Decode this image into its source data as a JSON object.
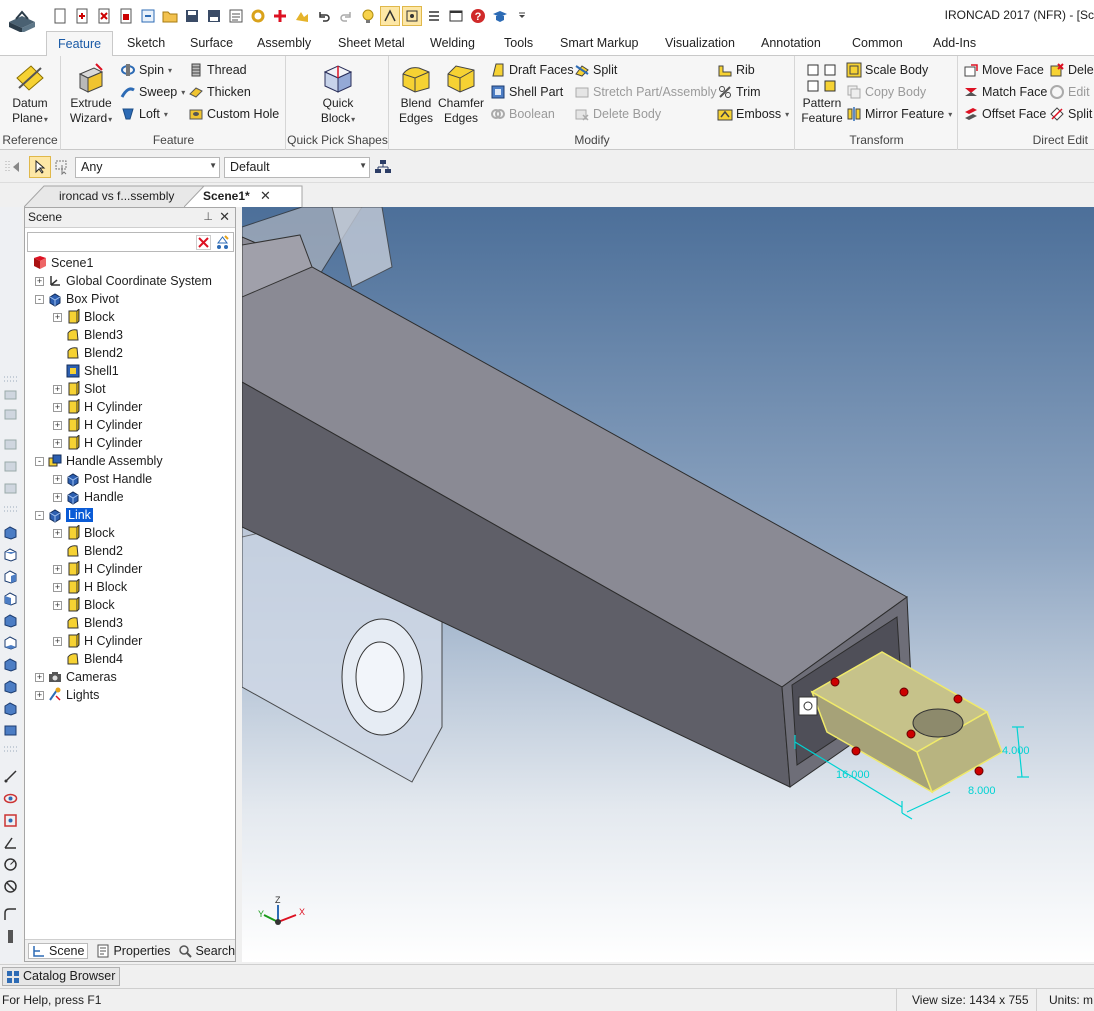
{
  "titlebar": {
    "title": "IRONCAD 2017 (NFR) - [Sc"
  },
  "ribbon_tabs": [
    "Feature",
    "Sketch",
    "Surface",
    "Assembly",
    "Sheet Metal",
    "Welding",
    "Tools",
    "Smart Markup",
    "Visualization",
    "Annotation",
    "Common",
    "Add-Ins"
  ],
  "ribbon": {
    "reference": {
      "label": "Reference",
      "datum": "Datum",
      "datum2": "Plane"
    },
    "feature": {
      "label": "Feature",
      "extrude": "Extrude",
      "extrude2": "Wizard",
      "spin": "Spin",
      "sweep": "Sweep",
      "loft": "Loft",
      "thread": "Thread",
      "thicken": "Thicken",
      "custom_hole": "Custom Hole"
    },
    "quickpick": {
      "label": "Quick Pick Shapes",
      "quick": "Quick",
      "block": "Block"
    },
    "modify": {
      "label": "Modify",
      "blend": "Blend",
      "blend2": "Edges",
      "chamfer": "Chamfer",
      "chamfer2": "Edges",
      "draft_faces": "Draft Faces",
      "shell_part": "Shell Part",
      "boolean": "Boolean",
      "split": "Split",
      "stretch": "Stretch Part/Assembly",
      "delete_body": "Delete Body",
      "rib": "Rib",
      "trim": "Trim",
      "emboss": "Emboss"
    },
    "transform": {
      "label": "Transform",
      "pattern": "Pattern",
      "pattern2": "Feature",
      "scale_body": "Scale Body",
      "copy_body": "Copy Body",
      "mirror": "Mirror Feature"
    },
    "direct_edit": {
      "label": "Direct Edit",
      "move_face": "Move Face",
      "match_face": "Match Face",
      "offset_face": "Offset Face",
      "dele": "Dele",
      "edit": "Edit",
      "split": "Split"
    }
  },
  "selection": {
    "filter": "Any",
    "mode": "Default"
  },
  "doc_tabs": [
    "ironcad vs f...ssembly",
    "Scene1*"
  ],
  "scene_panel": {
    "title": "Scene",
    "tree": [
      {
        "label": "Scene1",
        "indent": 0,
        "exp": "",
        "icon": "scene"
      },
      {
        "label": "Global Coordinate System",
        "indent": 1,
        "exp": "+",
        "icon": "axes"
      },
      {
        "label": "Box Pivot",
        "indent": 1,
        "exp": "-",
        "icon": "part"
      },
      {
        "label": "Block",
        "indent": 2,
        "exp": "+",
        "icon": "feat"
      },
      {
        "label": "Blend3",
        "indent": 2,
        "exp": "",
        "icon": "blend"
      },
      {
        "label": "Blend2",
        "indent": 2,
        "exp": "",
        "icon": "blend"
      },
      {
        "label": "Shell1",
        "indent": 2,
        "exp": "",
        "icon": "shell"
      },
      {
        "label": "Slot",
        "indent": 2,
        "exp": "+",
        "icon": "feat"
      },
      {
        "label": "H Cylinder",
        "indent": 2,
        "exp": "+",
        "icon": "feat"
      },
      {
        "label": "H Cylinder",
        "indent": 2,
        "exp": "+",
        "icon": "feat"
      },
      {
        "label": "H Cylinder",
        "indent": 2,
        "exp": "+",
        "icon": "feat"
      },
      {
        "label": "Handle Assembly",
        "indent": 1,
        "exp": "-",
        "icon": "assembly"
      },
      {
        "label": "Post Handle",
        "indent": 2,
        "exp": "+",
        "icon": "part"
      },
      {
        "label": "Handle",
        "indent": 2,
        "exp": "+",
        "icon": "part"
      },
      {
        "label": "Link",
        "indent": 1,
        "exp": "-",
        "icon": "part",
        "selected": true
      },
      {
        "label": "Block",
        "indent": 2,
        "exp": "+",
        "icon": "feat"
      },
      {
        "label": "Blend2",
        "indent": 2,
        "exp": "",
        "icon": "blend"
      },
      {
        "label": "H Cylinder",
        "indent": 2,
        "exp": "+",
        "icon": "feat"
      },
      {
        "label": "H Block",
        "indent": 2,
        "exp": "+",
        "icon": "feat"
      },
      {
        "label": "Block",
        "indent": 2,
        "exp": "+",
        "icon": "feat"
      },
      {
        "label": "Blend3",
        "indent": 2,
        "exp": "",
        "icon": "blend"
      },
      {
        "label": "H Cylinder",
        "indent": 2,
        "exp": "+",
        "icon": "feat"
      },
      {
        "label": "Blend4",
        "indent": 2,
        "exp": "",
        "icon": "blend"
      },
      {
        "label": "Cameras",
        "indent": 1,
        "exp": "+",
        "icon": "camera"
      },
      {
        "label": "Lights",
        "indent": 1,
        "exp": "+",
        "icon": "light"
      }
    ],
    "bottom_tabs": {
      "scene": "Scene",
      "properties": "Properties",
      "search": "Search"
    }
  },
  "viewport": {
    "dims": {
      "length": "16.000",
      "width": "8.000",
      "height": "4.000"
    },
    "axes": {
      "x": "X",
      "y": "Y",
      "z": "Z"
    }
  },
  "catalog": {
    "label": "Catalog Browser"
  },
  "status": {
    "help": "For Help, press F1",
    "view_size": "View size: 1434 x  755",
    "units": "Units: m"
  },
  "colors": {
    "accent": "#1a5aa6",
    "selection": "#0a5bd6",
    "dimension": "#00d3d3",
    "part_face": "#5e5f68"
  }
}
